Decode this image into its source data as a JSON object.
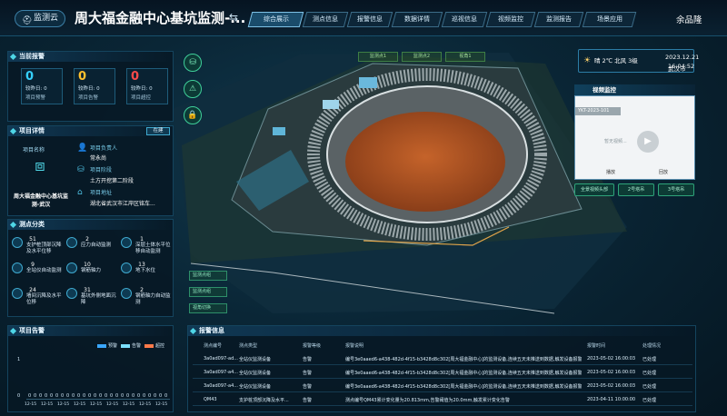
{
  "header": {
    "logo": "监测云",
    "title": "周大福金融中心基坑监测-...",
    "tabs": [
      "综合展示",
      "测点信息",
      "报警信息",
      "数据详情",
      "巡视信息",
      "视频监控",
      "监测报告",
      "场景应用"
    ],
    "active_tab": 0,
    "user": "余品隆"
  },
  "weather": {
    "condition": "晴 2℃ 北风 3级",
    "city": "武汉市",
    "date": "2023.12.21",
    "time": "16:04:52"
  },
  "current_alarm": {
    "title": "当前报警",
    "cards": [
      {
        "value": "0",
        "color": "#35d1ff",
        "sub": "较昨日: 0",
        "label": "项目预警"
      },
      {
        "value": "0",
        "color": "#ffc12e",
        "sub": "较昨日: 0",
        "label": "项目告警"
      },
      {
        "value": "0",
        "color": "#ff4a4a",
        "sub": "较昨日: 0",
        "label": "项目超控"
      }
    ]
  },
  "project": {
    "title": "项目详情",
    "status": "在建",
    "name_label": "项目名称",
    "name": "周大福金融中心基坑监测-武汉",
    "owner_label": "项目负责人",
    "owner": "常永尚",
    "stage_label": "项目阶段",
    "stage": "土方开挖第二阶段",
    "address_label": "项目地址",
    "address": "湖北省武汉市江岸区铭车..."
  },
  "categories": {
    "title": "测点分类",
    "items": [
      {
        "count": "51",
        "label": "支护桩顶部沉降及水平位移"
      },
      {
        "count": "2",
        "label": "应力自动监测"
      },
      {
        "count": "1",
        "label": "深层土体水平位移自动监测"
      },
      {
        "count": "9",
        "label": "全站仪自动监测"
      },
      {
        "count": "10",
        "label": "钢筋轴力"
      },
      {
        "count": "13",
        "label": "地下水位"
      },
      {
        "count": "24",
        "label": "墙间沉降及水平位移"
      },
      {
        "count": "31",
        "label": "基坑外侧地面沉降"
      },
      {
        "count": "2",
        "label": "钢筋轴力自动监测"
      }
    ]
  },
  "trend": {
    "title": "项目告警",
    "legend": [
      "预警",
      "告警",
      "超控"
    ],
    "legend_colors": [
      "#3aa7ff",
      "#7be0ff",
      "#ff7a4a"
    ],
    "y_ticks": [
      "1",
      "0"
    ],
    "x_labels": [
      "12-15",
      "12-15",
      "12-15",
      "12-15",
      "12-15",
      "12-15",
      "12-15",
      "12-15",
      "12-15"
    ],
    "values": [
      "0",
      "0",
      "0",
      "0",
      "0",
      "0",
      "0",
      "0",
      "0",
      "0",
      "0",
      "0",
      "0",
      "0",
      "0",
      "0",
      "0",
      "0",
      "0",
      "0",
      "0",
      "0",
      "0",
      "0",
      "0",
      "0"
    ]
  },
  "alarm_info": {
    "title": "报警信息",
    "columns": [
      "测点编号",
      "测点类型",
      "报警等级",
      "报警说明",
      "报警时间",
      "处理情况"
    ],
    "rows": [
      [
        "3a0ad097-ad...",
        "全站仪监测设备",
        "告警",
        "编号3e0aaed6-a438-482d-4f15-b3428d8c302[周大福金融中心]的监测设备,连续五天未推送到数据,触发设备报警",
        "2023-05-02 16:00:03",
        "已处理"
      ],
      [
        "3a0ad097-a4...",
        "全站仪监测设备",
        "告警",
        "编号3e0aaed6-a438-482d-4f15-b3428d8c302[周大福金融中心]的监测设备,连续五天未推送到数据,触发设备报警",
        "2023-05-02 16:00:03",
        "已处理"
      ],
      [
        "3a0ad097-a4...",
        "全站仪监测设备",
        "告警",
        "编号3e0aaed6-a438-482d-4f15-b3428d8c302[周大福金融中心]的监测设备,连续五天未推送到数据,触发设备报警",
        "2023-05-02 16:00:03",
        "已处理"
      ],
      [
        "QM43",
        "支护桩顶部沉降及水平...",
        "告警",
        "测点编号QM43累计变化量为20.813mm,告警阈值为20.0mm,触发累计变化告警",
        "2023-04-11 10:00:00",
        "已处理"
      ]
    ]
  },
  "scene": {
    "top_buttons": [
      "监测点1",
      "监测点2",
      "视角1"
    ],
    "left_buttons": [
      "监测点组",
      "监测点组",
      "视角切换"
    ]
  },
  "video": {
    "title": "视频监控",
    "camera": "YKT-2023-101",
    "placeholder": "暂无视频...",
    "buttons": [
      "播放",
      "回放"
    ],
    "gates": [
      "全景视频头部",
      "2号塔吊",
      "3号塔吊"
    ]
  }
}
